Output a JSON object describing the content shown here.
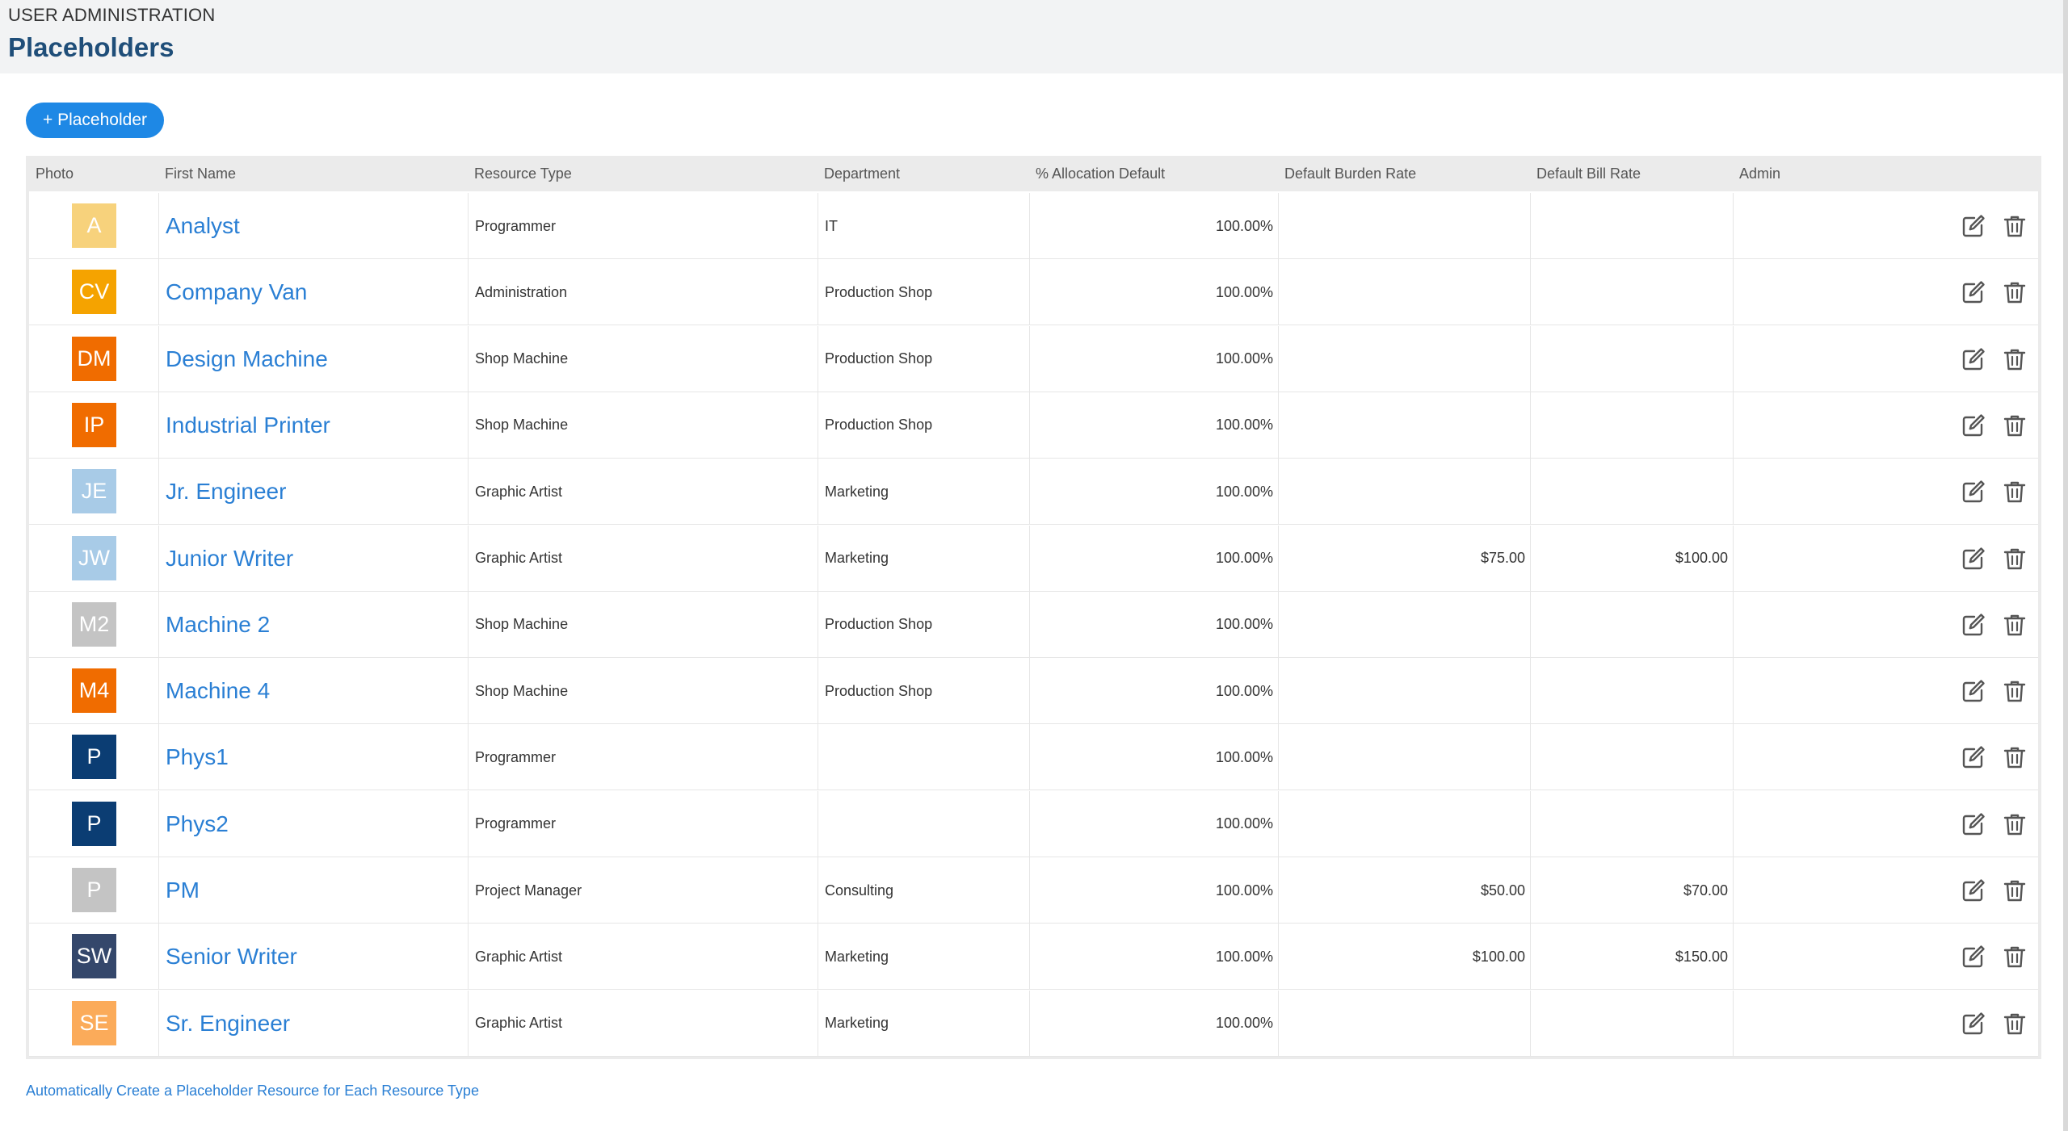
{
  "header": {
    "eyebrow": "USER ADMINISTRATION",
    "title": "Placeholders"
  },
  "toolbar": {
    "add_label": "+ Placeholder"
  },
  "table": {
    "columns": [
      "Photo",
      "First Name",
      "Resource Type",
      "Department",
      "% Allocation Default",
      "Default Burden Rate",
      "Default Bill Rate",
      "Admin"
    ],
    "rows": [
      {
        "initials": "A",
        "color": "#f7d27c",
        "name": "Analyst",
        "resource_type": "Programmer",
        "department": "IT",
        "allocation": "100.00%",
        "burden_rate": "",
        "bill_rate": ""
      },
      {
        "initials": "CV",
        "color": "#f5a300",
        "name": "Company Van",
        "resource_type": "Administration",
        "department": "Production Shop",
        "allocation": "100.00%",
        "burden_rate": "",
        "bill_rate": ""
      },
      {
        "initials": "DM",
        "color": "#f06c00",
        "name": "Design Machine",
        "resource_type": "Shop Machine",
        "department": "Production Shop",
        "allocation": "100.00%",
        "burden_rate": "",
        "bill_rate": ""
      },
      {
        "initials": "IP",
        "color": "#f06c00",
        "name": "Industrial Printer",
        "resource_type": "Shop Machine",
        "department": "Production Shop",
        "allocation": "100.00%",
        "burden_rate": "",
        "bill_rate": ""
      },
      {
        "initials": "JE",
        "color": "#a8cbe7",
        "name": "Jr. Engineer",
        "resource_type": "Graphic Artist",
        "department": "Marketing",
        "allocation": "100.00%",
        "burden_rate": "",
        "bill_rate": ""
      },
      {
        "initials": "JW",
        "color": "#a8cbe7",
        "name": "Junior Writer",
        "resource_type": "Graphic Artist",
        "department": "Marketing",
        "allocation": "100.00%",
        "burden_rate": "$75.00",
        "bill_rate": "$100.00"
      },
      {
        "initials": "M2",
        "color": "#c4c4c4",
        "name": "Machine 2",
        "resource_type": "Shop Machine",
        "department": "Production Shop",
        "allocation": "100.00%",
        "burden_rate": "",
        "bill_rate": ""
      },
      {
        "initials": "M4",
        "color": "#f06c00",
        "name": "Machine 4",
        "resource_type": "Shop Machine",
        "department": "Production Shop",
        "allocation": "100.00%",
        "burden_rate": "",
        "bill_rate": ""
      },
      {
        "initials": "P",
        "color": "#0b3d73",
        "name": "Phys1",
        "resource_type": "Programmer",
        "department": "",
        "allocation": "100.00%",
        "burden_rate": "",
        "bill_rate": ""
      },
      {
        "initials": "P",
        "color": "#0b3d73",
        "name": "Phys2",
        "resource_type": "Programmer",
        "department": "",
        "allocation": "100.00%",
        "burden_rate": "",
        "bill_rate": ""
      },
      {
        "initials": "P",
        "color": "#c4c4c4",
        "name": "PM",
        "resource_type": "Project Manager",
        "department": "Consulting",
        "allocation": "100.00%",
        "burden_rate": "$50.00",
        "bill_rate": "$70.00"
      },
      {
        "initials": "SW",
        "color": "#34476b",
        "name": "Senior Writer",
        "resource_type": "Graphic Artist",
        "department": "Marketing",
        "allocation": "100.00%",
        "burden_rate": "$100.00",
        "bill_rate": "$150.00"
      },
      {
        "initials": "SE",
        "color": "#fbab5a",
        "name": "Sr. Engineer",
        "resource_type": "Graphic Artist",
        "department": "Marketing",
        "allocation": "100.00%",
        "burden_rate": "",
        "bill_rate": ""
      }
    ],
    "icons": {
      "edit": "edit-icon",
      "delete": "trash-icon"
    }
  },
  "footer": {
    "link_label": "Automatically Create a Placeholder Resource for Each Resource Type"
  }
}
